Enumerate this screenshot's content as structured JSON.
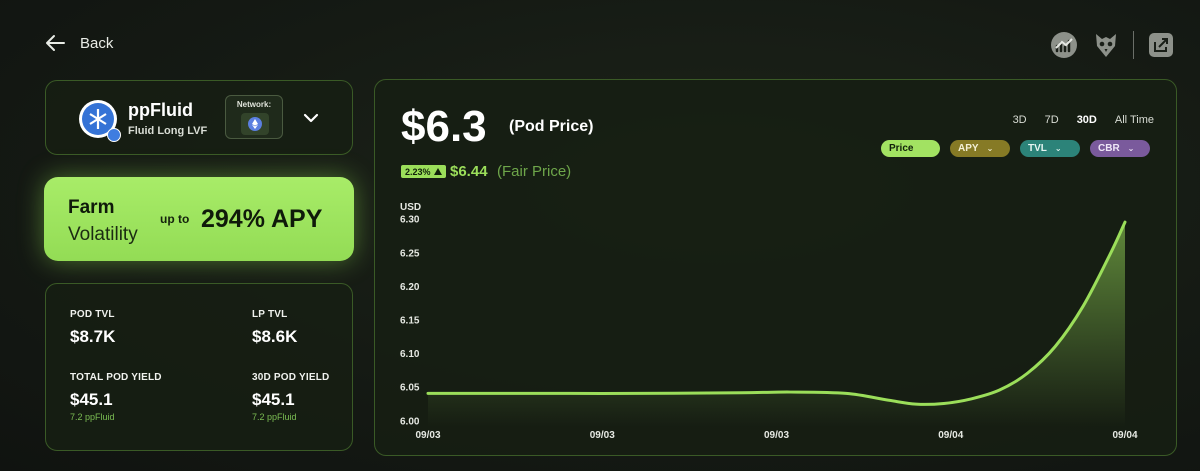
{
  "nav": {
    "back_label": "Back"
  },
  "top_icons": [
    "chart-logo-icon",
    "owl-logo-icon",
    "share-icon"
  ],
  "token": {
    "name": "ppFluid",
    "subtitle": "Fluid Long LVF",
    "network_label": "Network:",
    "network_icon": "ethereum-icon"
  },
  "farm": {
    "title": "Farm",
    "subtitle": "Volatility",
    "up_to": "up to",
    "apy": "294% APY"
  },
  "stats": [
    {
      "label": "POD TVL",
      "value": "$8.7K",
      "sub": ""
    },
    {
      "label": "LP TVL",
      "value": "$8.6K",
      "sub": ""
    },
    {
      "label": "TOTAL POD YIELD",
      "value": "$45.1",
      "sub": "7.2 ppFluid"
    },
    {
      "label": "30D POD YIELD",
      "value": "$45.1",
      "sub": "7.2 ppFluid"
    }
  ],
  "price": {
    "value": "$6.3",
    "label": "(Pod Price)",
    "change_pct": "2.23%",
    "fair_value": "$6.44",
    "fair_label": "(Fair Price)"
  },
  "ranges": [
    "3D",
    "7D",
    "30D",
    "All Time"
  ],
  "active_range": "30D",
  "pills": [
    {
      "label": "Price",
      "bg": "#a2e262",
      "fg": "#10200a",
      "dropdown": false
    },
    {
      "label": "APY",
      "bg": "#867a25",
      "fg": "#f3f0d6",
      "dropdown": true
    },
    {
      "label": "TVL",
      "bg": "#2c8379",
      "fg": "#e6f5f2",
      "dropdown": true
    },
    {
      "label": "CBR",
      "bg": "#7a5a9c",
      "fg": "#efe6f7",
      "dropdown": true
    }
  ],
  "colors": {
    "accent": "#9bde5a",
    "card_border": "#3a5a26",
    "background": "#151a14"
  },
  "chart_data": {
    "type": "area",
    "ylabel": "USD",
    "ylim": [
      5.99,
      6.31
    ],
    "yticks": [
      "6.30",
      "6.25",
      "6.20",
      "6.15",
      "6.10",
      "6.05",
      "6.00"
    ],
    "xticks": [
      "09/03",
      "09/03",
      "09/03",
      "09/04",
      "09/04"
    ],
    "series": [
      {
        "values": [
          [
            0,
            6.04
          ],
          [
            0.15,
            6.04
          ],
          [
            0.3,
            6.04
          ],
          [
            0.45,
            6.041
          ],
          [
            0.52,
            6.042
          ],
          [
            0.6,
            6.04
          ],
          [
            0.66,
            6.03
          ],
          [
            0.7,
            6.024
          ],
          [
            0.74,
            6.025
          ],
          [
            0.78,
            6.032
          ],
          [
            0.82,
            6.045
          ],
          [
            0.86,
            6.07
          ],
          [
            0.9,
            6.11
          ],
          [
            0.94,
            6.17
          ],
          [
            0.98,
            6.25
          ],
          [
            1.0,
            6.295
          ]
        ]
      }
    ]
  }
}
